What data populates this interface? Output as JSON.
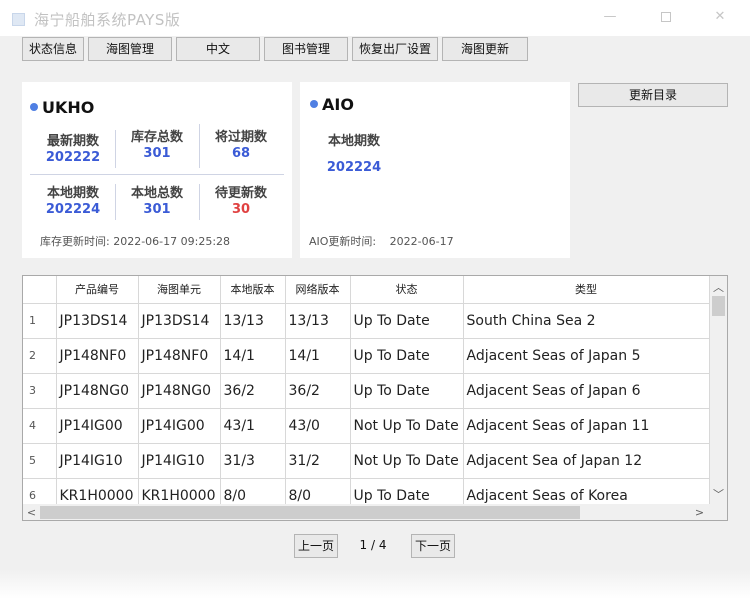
{
  "window": {
    "title": "海宁船舶系统PAYS版",
    "min_glyph": "—",
    "close_glyph": "✕"
  },
  "toolbar": {
    "buttons": [
      "状态信息",
      "海图管理",
      "中文",
      "图书管理",
      "恢复出厂设置",
      "海图更新"
    ]
  },
  "ukho": {
    "title": "UKHO",
    "stats": [
      {
        "label": "最新期数",
        "value": "202222",
        "color": "#3b5bd6"
      },
      {
        "label": "库存总数",
        "value": "301",
        "color": "#3b5bd6"
      },
      {
        "label": "将过期数",
        "value": "68",
        "color": "#3b5bd6"
      },
      {
        "label": "本地期数",
        "value": "202224",
        "color": "#3b5bd6"
      },
      {
        "label": "本地总数",
        "value": "301",
        "color": "#3b5bd6"
      },
      {
        "label": "待更新数",
        "value": "30",
        "color": "#e04141"
      }
    ],
    "footer_label": "库存更新时间:",
    "footer_value": "2022-06-17 09:25:28"
  },
  "aio": {
    "title": "AIO",
    "label": "本地期数",
    "value": "202224",
    "footer_label": "AIO更新时间:",
    "footer_value": "2022-06-17"
  },
  "update_catalog_label": "更新目录",
  "table": {
    "headers": [
      "",
      "产品编号",
      "海图单元",
      "本地版本",
      "网络版本",
      "状态",
      "类型"
    ],
    "rows": [
      [
        "1",
        "JP13DS14",
        "JP13DS14",
        "13/13",
        "13/13",
        "Up To Date",
        "South China Sea 2"
      ],
      [
        "2",
        "JP148NF0",
        "JP148NF0",
        "14/1",
        "14/1",
        "Up To Date",
        "Adjacent Seas of Japan 5"
      ],
      [
        "3",
        "JP148NG0",
        "JP148NG0",
        "36/2",
        "36/2",
        "Up To Date",
        "Adjacent Seas of Japan 6"
      ],
      [
        "4",
        "JP14IG00",
        "JP14IG00",
        "43/1",
        "43/0",
        "Not Up To Date",
        "Adjacent Seas of Japan 11"
      ],
      [
        "5",
        "JP14IG10",
        "JP14IG10",
        "31/3",
        "31/2",
        "Not Up To Date",
        "Adjacent Sea of Japan 12"
      ],
      [
        "6",
        "KR1H0000",
        "KR1H0000",
        "8/0",
        "8/0",
        "Up To Date",
        "Adjacent Seas of Korea"
      ]
    ]
  },
  "pager": {
    "prev_label": "上一页",
    "page_text": "1 / 4",
    "next_label": "下一页"
  }
}
